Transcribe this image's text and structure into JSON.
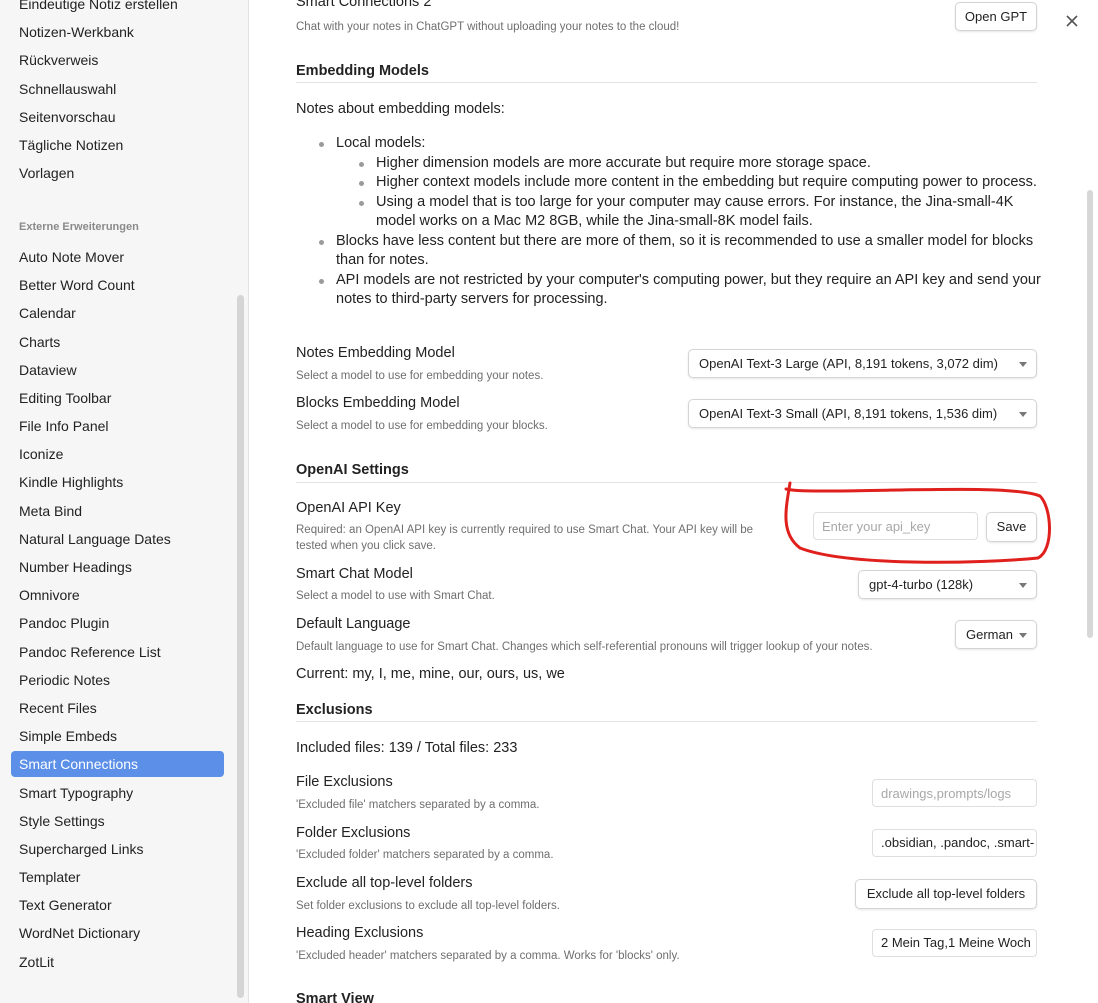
{
  "sidebar": {
    "top_items": [
      {
        "label": "Eindeutige Notiz erstellen"
      },
      {
        "label": "Notizen-Werkbank"
      },
      {
        "label": "Rückverweis"
      },
      {
        "label": "Schnellauswahl"
      },
      {
        "label": "Seitenvorschau"
      },
      {
        "label": "Tägliche Notizen"
      },
      {
        "label": "Vorlagen"
      }
    ],
    "group_title": "Externe Erweiterungen",
    "plugins": [
      {
        "label": "Auto Note Mover"
      },
      {
        "label": "Better Word Count"
      },
      {
        "label": "Calendar"
      },
      {
        "label": "Charts"
      },
      {
        "label": "Dataview"
      },
      {
        "label": "Editing Toolbar"
      },
      {
        "label": "File Info Panel"
      },
      {
        "label": "Iconize"
      },
      {
        "label": "Kindle Highlights"
      },
      {
        "label": "Meta Bind"
      },
      {
        "label": "Natural Language Dates"
      },
      {
        "label": "Number Headings"
      },
      {
        "label": "Omnivore"
      },
      {
        "label": "Pandoc Plugin"
      },
      {
        "label": "Pandoc Reference List"
      },
      {
        "label": "Periodic Notes"
      },
      {
        "label": "Recent Files"
      },
      {
        "label": "Simple Embeds"
      },
      {
        "label": "Smart Connections"
      },
      {
        "label": "Smart Typography"
      },
      {
        "label": "Style Settings"
      },
      {
        "label": "Supercharged Links"
      },
      {
        "label": "Templater"
      },
      {
        "label": "Text Generator"
      },
      {
        "label": "WordNet Dictionary"
      },
      {
        "label": "ZotLit"
      }
    ],
    "active": "Smart Connections"
  },
  "top_setting": {
    "name": "Smart Connections 2",
    "desc": "Chat with your notes in ChatGPT without uploading your notes to the cloud!",
    "button": "Open GPT"
  },
  "embedding": {
    "heading": "Embedding Models",
    "intro": "Notes about embedding models:",
    "local_models": "Local models:",
    "local_sub": [
      "Higher dimension models are more accurate but require more storage space.",
      "Higher context models include more content in the embedding but require computing power to process.",
      "Using a model that is too large for your computer may cause errors. For instance, the Jina-small-4K model works on a Mac M2 8GB, while the Jina-small-8K model fails."
    ],
    "blocks_note": "Blocks have less content but there are more of them, so it is recommended to use a smaller model for blocks than for notes.",
    "api_note": "API models are not restricted by your computer's computing power, but they require an API key and send your notes to third-party servers for processing.",
    "notes_model": {
      "name": "Notes Embedding Model",
      "desc": "Select a model to use for embedding your notes.",
      "value": "OpenAI Text-3 Large (API, 8,191 tokens, 3,072 dim)"
    },
    "blocks_model": {
      "name": "Blocks Embedding Model",
      "desc": "Select a model to use for embedding your blocks.",
      "value": "OpenAI Text-3 Small (API, 8,191 tokens, 1,536 dim)"
    }
  },
  "openai": {
    "heading": "OpenAI Settings",
    "api_key": {
      "name": "OpenAI API Key",
      "desc": "Required: an OpenAI API key is currently required to use Smart Chat. Your API key will be tested when you click save.",
      "placeholder": "Enter your api_key",
      "button": "Save"
    },
    "chat_model": {
      "name": "Smart Chat Model",
      "desc": "Select a model to use with Smart Chat.",
      "value": "gpt-4-turbo (128k)"
    },
    "language": {
      "name": "Default Language",
      "desc": "Default language to use for Smart Chat. Changes which self-referential pronouns will trigger lookup of your notes.",
      "value": "German"
    },
    "current": "Current: my, I, me, mine, our, ours, us, we"
  },
  "exclusions": {
    "heading": "Exclusions",
    "counts": "Included files: 139 / Total files: 233",
    "file": {
      "name": "File Exclusions",
      "desc": "'Excluded file' matchers separated by a comma.",
      "placeholder": "drawings,prompts/logs"
    },
    "folder": {
      "name": "Folder Exclusions",
      "desc": "'Excluded folder' matchers separated by a comma.",
      "value": ".obsidian, .pandoc, .smart-"
    },
    "top_level": {
      "name": "Exclude all top-level folders",
      "desc": "Set folder exclusions to exclude all top-level folders.",
      "button": "Exclude all top-level folders"
    },
    "heading_ex": {
      "name": "Heading Exclusions",
      "desc": "'Excluded header' matchers separated by a comma. Works for 'blocks' only.",
      "value": "2 Mein Tag,1 Meine Woch"
    }
  },
  "next_heading": "Smart View",
  "colors": {
    "accent": "#5b8fe8",
    "annotation": "#e0201c"
  }
}
